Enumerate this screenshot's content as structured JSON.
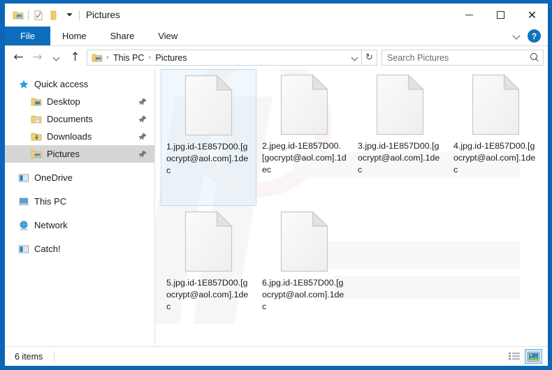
{
  "window": {
    "title": "Pictures",
    "frame_color": "#0c66b7",
    "controls": {
      "minimize": "Minimize",
      "maximize": "Maximize",
      "close": "Close"
    }
  },
  "quick_access_toolbar": {
    "items": [
      {
        "name": "explorer-icon",
        "label": "File Explorer"
      },
      {
        "name": "properties-icon",
        "label": "Properties"
      },
      {
        "name": "new-folder-icon",
        "label": "New folder"
      },
      {
        "name": "customize-chevron-icon",
        "label": "Customize Quick Access Toolbar"
      }
    ]
  },
  "ribbon": {
    "tabs": [
      {
        "label": "File",
        "selected": true
      },
      {
        "label": "Home",
        "selected": false
      },
      {
        "label": "Share",
        "selected": false
      },
      {
        "label": "View",
        "selected": false
      }
    ],
    "expand_label": "Expand the Ribbon",
    "help_label": "?",
    "file_tab_color": "#0e6cbd"
  },
  "address_bar": {
    "back_label": "Back",
    "forward_label": "Forward",
    "recent_label": "Recent locations",
    "up_label": "Up",
    "breadcrumb": [
      {
        "label": "This PC"
      },
      {
        "label": "Pictures"
      }
    ],
    "breadcrumb_separator": "›",
    "dropdown_label": "Previous locations",
    "refresh_label": "Refresh",
    "search": {
      "value": "",
      "placeholder": "Search Pictures"
    }
  },
  "sidebar": {
    "items": [
      {
        "label": "Quick access",
        "icon": "star-icon",
        "level": "root",
        "selected": false,
        "pinned": false
      },
      {
        "label": "Desktop",
        "icon": "folder-desktop-icon",
        "level": "indent",
        "selected": false,
        "pinned": true
      },
      {
        "label": "Documents",
        "icon": "folder-documents-icon",
        "level": "indent",
        "selected": false,
        "pinned": true
      },
      {
        "label": "Downloads",
        "icon": "folder-downloads-icon",
        "level": "indent",
        "selected": false,
        "pinned": true
      },
      {
        "label": "Pictures",
        "icon": "folder-pictures-icon",
        "level": "indent",
        "selected": true,
        "pinned": true
      },
      {
        "label": "OneDrive",
        "icon": "onedrive-icon",
        "level": "root",
        "selected": false,
        "pinned": false,
        "gap_before": true
      },
      {
        "label": "This PC",
        "icon": "this-pc-icon",
        "level": "root",
        "selected": false,
        "pinned": false,
        "gap_before": true
      },
      {
        "label": "Network",
        "icon": "network-icon",
        "level": "root",
        "selected": false,
        "pinned": false,
        "gap_before": true
      },
      {
        "label": "Catch!",
        "icon": "catch-icon",
        "level": "root",
        "selected": false,
        "pinned": false,
        "gap_before": true
      }
    ],
    "selected_color": "#d5d5d5"
  },
  "files": [
    {
      "name": "1.jpg.id-1E857D00.[gocrypt@aol.com].1dec",
      "icon": "blank-document-icon",
      "selected": true
    },
    {
      "name": "2.jpeg.id-1E857D00.[gocrypt@aol.com].1dec",
      "icon": "blank-document-icon",
      "selected": false
    },
    {
      "name": "3.jpg.id-1E857D00.[gocrypt@aol.com].1dec",
      "icon": "blank-document-icon",
      "selected": false
    },
    {
      "name": "4.jpg.id-1E857D00.[gocrypt@aol.com].1dec",
      "icon": "blank-document-icon",
      "selected": false
    },
    {
      "name": "5.jpg.id-1E857D00.[gocrypt@aol.com].1dec",
      "icon": "blank-document-icon",
      "selected": false
    },
    {
      "name": "6.jpg.id-1E857D00.[gocrypt@aol.com].1dec",
      "icon": "blank-document-icon",
      "selected": false
    }
  ],
  "status_bar": {
    "item_count": "6 items",
    "views": [
      {
        "name": "details-view-button",
        "label": "Details view",
        "active": false
      },
      {
        "name": "large-icons-view-button",
        "label": "Large icons view",
        "active": true
      }
    ]
  },
  "colors": {
    "accent": "#0c66b7",
    "selection_border": "#b6dcf2",
    "view_active": "#cde8f7"
  }
}
